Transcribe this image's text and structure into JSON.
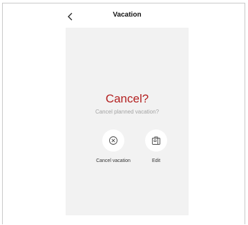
{
  "header": {
    "title": "Vacation",
    "back_icon": "chevron-left-icon"
  },
  "dialog": {
    "heading": "Cancel?",
    "subtitle": "Cancel planned vacation?",
    "heading_color": "#b31f1f",
    "actions": [
      {
        "label": "Cancel vacation",
        "icon": "close-circle-icon"
      },
      {
        "label": "Edit",
        "icon": "suitcase-icon"
      }
    ]
  }
}
